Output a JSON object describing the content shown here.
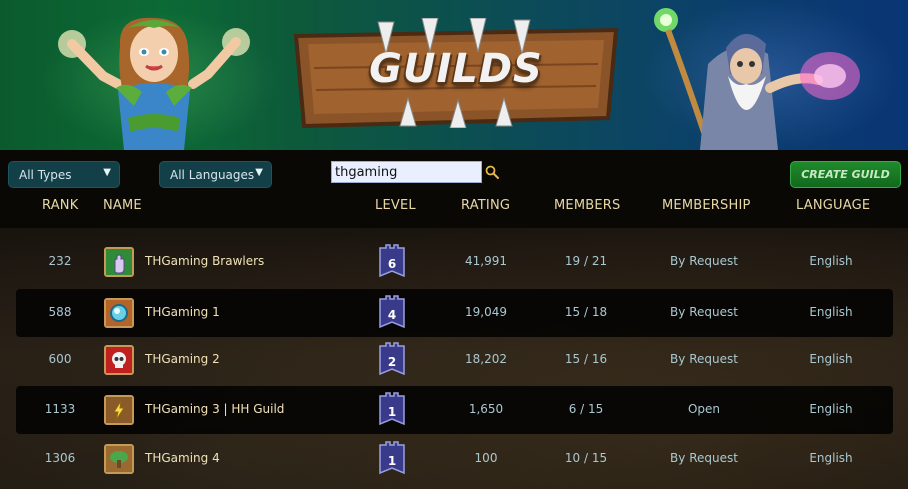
{
  "banner": {
    "title": "GUILDS"
  },
  "filters": {
    "types": {
      "selected": "All Types"
    },
    "languages": {
      "selected": "All Languages"
    }
  },
  "search": {
    "value": "thgaming"
  },
  "create_button": {
    "label": "CREATE GUILD"
  },
  "columns": {
    "rank": "RANK",
    "name": "NAME",
    "level": "LEVEL",
    "rating": "RATING",
    "members": "MEMBERS",
    "membership": "MEMBERSHIP",
    "language": "LANGUAGE"
  },
  "guilds": [
    {
      "rank": "232",
      "name": "THGaming Brawlers",
      "level": "6",
      "rating": "41,991",
      "members": "19 / 21",
      "membership": "By Request",
      "language": "English",
      "emblem_color": "#2f8a3a",
      "emblem_icon": "hand-icon"
    },
    {
      "rank": "588",
      "name": "THGaming 1",
      "level": "4",
      "rating": "19,049",
      "members": "15 / 18",
      "membership": "By Request",
      "language": "English",
      "emblem_color": "#b4642a",
      "emblem_icon": "orb-icon"
    },
    {
      "rank": "600",
      "name": "THGaming 2",
      "level": "2",
      "rating": "18,202",
      "members": "15 / 16",
      "membership": "By Request",
      "language": "English",
      "emblem_color": "#c02020",
      "emblem_icon": "skull-icon"
    },
    {
      "rank": "1133",
      "name": "THGaming 3 | HH Guild",
      "level": "1",
      "rating": "1,650",
      "members": "6 / 15",
      "membership": "Open",
      "language": "English",
      "emblem_color": "#8a5a28",
      "emblem_icon": "lightning-icon"
    },
    {
      "rank": "1306",
      "name": "THGaming 4",
      "level": "1",
      "rating": "100",
      "members": "10 / 15",
      "membership": "By Request",
      "language": "English",
      "emblem_color": "#9a6a30",
      "emblem_icon": "tree-icon"
    }
  ]
}
